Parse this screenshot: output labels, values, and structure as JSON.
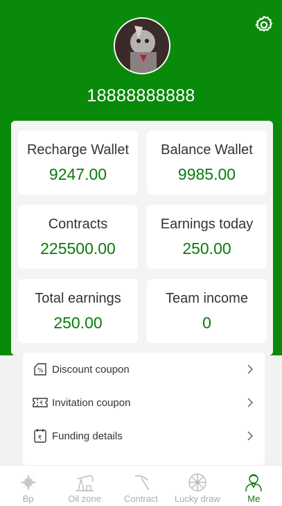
{
  "profile": {
    "phone": "18888888888"
  },
  "stats": [
    {
      "label": "Recharge Wallet",
      "value": "9247.00"
    },
    {
      "label": "Balance Wallet",
      "value": "9985.00"
    },
    {
      "label": "Contracts",
      "value": "225500.00"
    },
    {
      "label": "Earnings today",
      "value": "250.00"
    },
    {
      "label": "Total earnings",
      "value": "250.00"
    },
    {
      "label": "Team income",
      "value": "0"
    }
  ],
  "menu": [
    {
      "label": "Discount coupon",
      "icon": "discount-coupon-icon"
    },
    {
      "label": "Invitation coupon",
      "icon": "invitation-coupon-icon"
    },
    {
      "label": "Funding details",
      "icon": "funding-details-icon"
    }
  ],
  "tabs": [
    {
      "label": "Bp",
      "icon": "bp-icon",
      "active": false
    },
    {
      "label": "Oil zone",
      "icon": "oil-pump-icon",
      "active": false
    },
    {
      "label": "Contract",
      "icon": "pickaxe-icon",
      "active": false
    },
    {
      "label": "Lucky draw",
      "icon": "lucky-wheel-icon",
      "active": false
    },
    {
      "label": "Me",
      "icon": "user-icon",
      "active": true
    }
  ],
  "colors": {
    "brand_green": "#0a8a0a",
    "value_green": "#0a7a0a",
    "inactive_tab": "#aaaaaa"
  }
}
